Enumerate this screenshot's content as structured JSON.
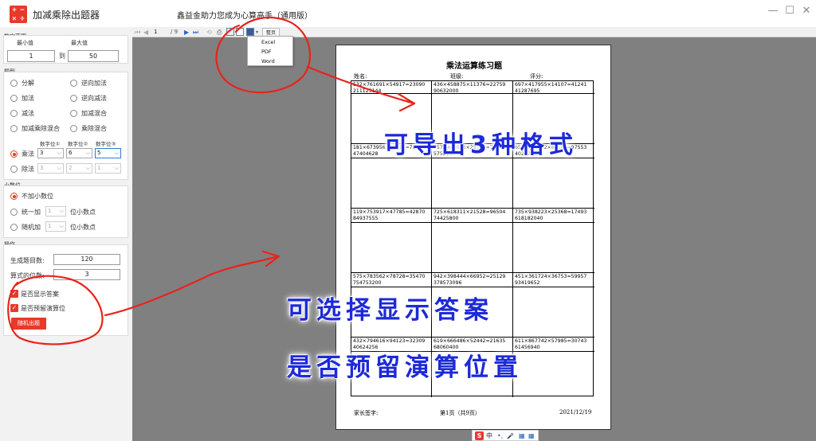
{
  "app": {
    "logo_glyphs": [
      "+",
      "−",
      "×",
      "÷"
    ],
    "title": "加减乘除出题器",
    "slogan": "鑫益金助力您成为心算高手（通用版）"
  },
  "window_controls": {
    "minimize": "—",
    "maximize": "☐",
    "close": "✕"
  },
  "number_range": {
    "group_title": "数字范围",
    "min_label": "最小值",
    "max_label": "最大值",
    "min_value": "1",
    "to_label": "到",
    "max_value": "50"
  },
  "question_type": {
    "group_title": "题型",
    "options": [
      "分解",
      "逆向加法",
      "加法",
      "逆向减法",
      "减法",
      "加减混合",
      "加减乘除混合",
      "乘除混合"
    ],
    "digit_headers": [
      "数字位①",
      "数字位②",
      "数字位③"
    ],
    "multiply_label": "乘法",
    "multiply_digits": [
      "3",
      "6",
      "5"
    ],
    "divide_label": "除法",
    "divide_digits": [
      "3",
      "2",
      "1"
    ]
  },
  "decimal": {
    "group_title": "小数位",
    "none_label": "不加小数位",
    "uniform_label": "统一加",
    "uniform_value": "1",
    "uniform_unit": "位小数点",
    "random_label": "随机加",
    "random_value": "1",
    "random_unit": "位小数点"
  },
  "operation": {
    "group_title": "操作",
    "count_label": "生成题目数:",
    "count_value": "120",
    "digits_label": "算式的位数:",
    "digits_value": "3",
    "show_answer_label": "是否显示答案",
    "reserve_space_label": "是否预留演算位",
    "generate_button": "随机出题"
  },
  "toolbar": {
    "first": "⏮",
    "prev": "◀",
    "page_input": "1",
    "page_total": "/ 9",
    "next": "▶",
    "last": "⏭",
    "export_button": "整页"
  },
  "export_menu": {
    "items": [
      "Excel",
      "PDF",
      "Word"
    ]
  },
  "paper": {
    "title": "乘法运算练习题",
    "name_label": "姓名:",
    "class_label": "班级:",
    "score_label": "评分:",
    "questions": [
      [
        "532×761691×54917=23090",
        "211125144"
      ],
      [
        "436×458875×11376=22759",
        "90632000"
      ],
      [
        "697×417955×14107=41241",
        "41287695"
      ],
      [
        "181×673956×12817=79923",
        "47404628"
      ],
      [
        "357×489533×25352=77147",
        "5752160"
      ],
      [
        "653×165312×81140=97553",
        "40267840"
      ],
      [
        "119×753917×47785=42870",
        "84937555"
      ],
      [
        "725×618311×21528=96504",
        "74425800"
      ],
      [
        "735×938223×25368=17493",
        "618182040"
      ],
      [
        "575×783562×78728=35470",
        "754753200"
      ],
      [
        "942×398444×66952=25129",
        "378573096"
      ],
      [
        "451×361724×36753=59957",
        "93419652"
      ],
      [
        "432×794616×94123=32309",
        "40624256"
      ],
      [
        "619×666486×52442=21635",
        "68060400"
      ],
      [
        "611×867742×57985=30743",
        "61456940"
      ]
    ],
    "parent_sign": "家长签字:",
    "page_info": "第1页（共9页）",
    "date": "2021/12/19"
  },
  "annotations": {
    "export_formats": "可导出3种格式",
    "show_answer": "可选择显示答案",
    "reserve_space": "是否预留演算位置"
  },
  "ime": {
    "logo": "S",
    "lang": "中",
    "items": [
      "•,",
      "🎤",
      "▦",
      "▦"
    ]
  }
}
